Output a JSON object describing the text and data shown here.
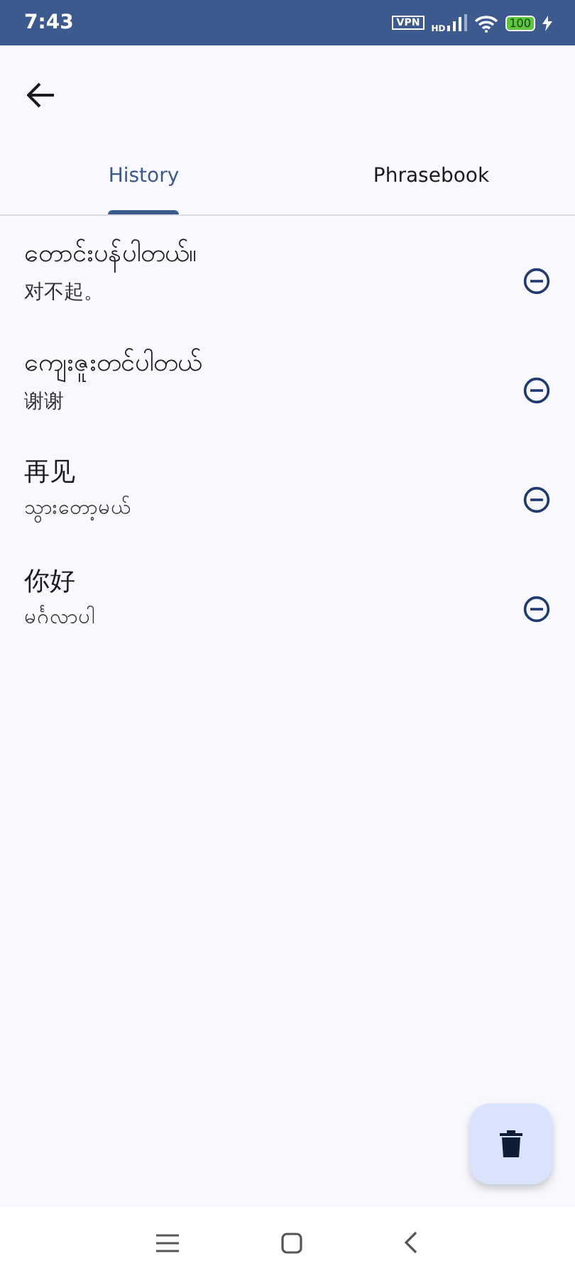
{
  "status_bar": {
    "time": "7:43",
    "vpn": "VPN",
    "network": "HD",
    "battery": "100"
  },
  "tabs": [
    {
      "label": "History",
      "selected": true
    },
    {
      "label": "Phrasebook",
      "selected": false
    }
  ],
  "history": [
    {
      "source": "တောင်းပန်ပါတယ်။",
      "translation": "对不起。"
    },
    {
      "source": "ကျေးဇူးတင်ပါတယ်",
      "translation": "谢谢"
    },
    {
      "source": "再见",
      "translation": "သွားတော့မယ်"
    },
    {
      "source": "你好",
      "translation": "မင်္ဂလာပါ"
    }
  ]
}
